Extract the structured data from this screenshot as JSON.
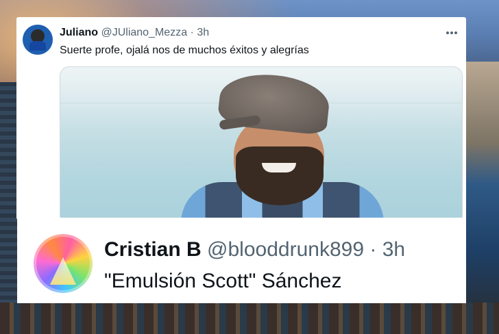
{
  "tweet1": {
    "display_name": "Juliano",
    "handle": "@JUliano_Mezza",
    "separator": "·",
    "time": "3h",
    "text": "Suerte profe, ojalá nos de muchos éxitos y alegrías",
    "more_icon": "more-horizontal-icon"
  },
  "tweet2": {
    "display_name": "Cristian B",
    "handle": "@blooddrunk899",
    "separator": "·",
    "time": "3h",
    "text": "\"Emulsión Scott\" Sánchez"
  },
  "colors": {
    "text_primary": "#0f1419",
    "text_secondary": "#536471",
    "card_bg": "#ffffff",
    "border": "#cfd9de"
  }
}
